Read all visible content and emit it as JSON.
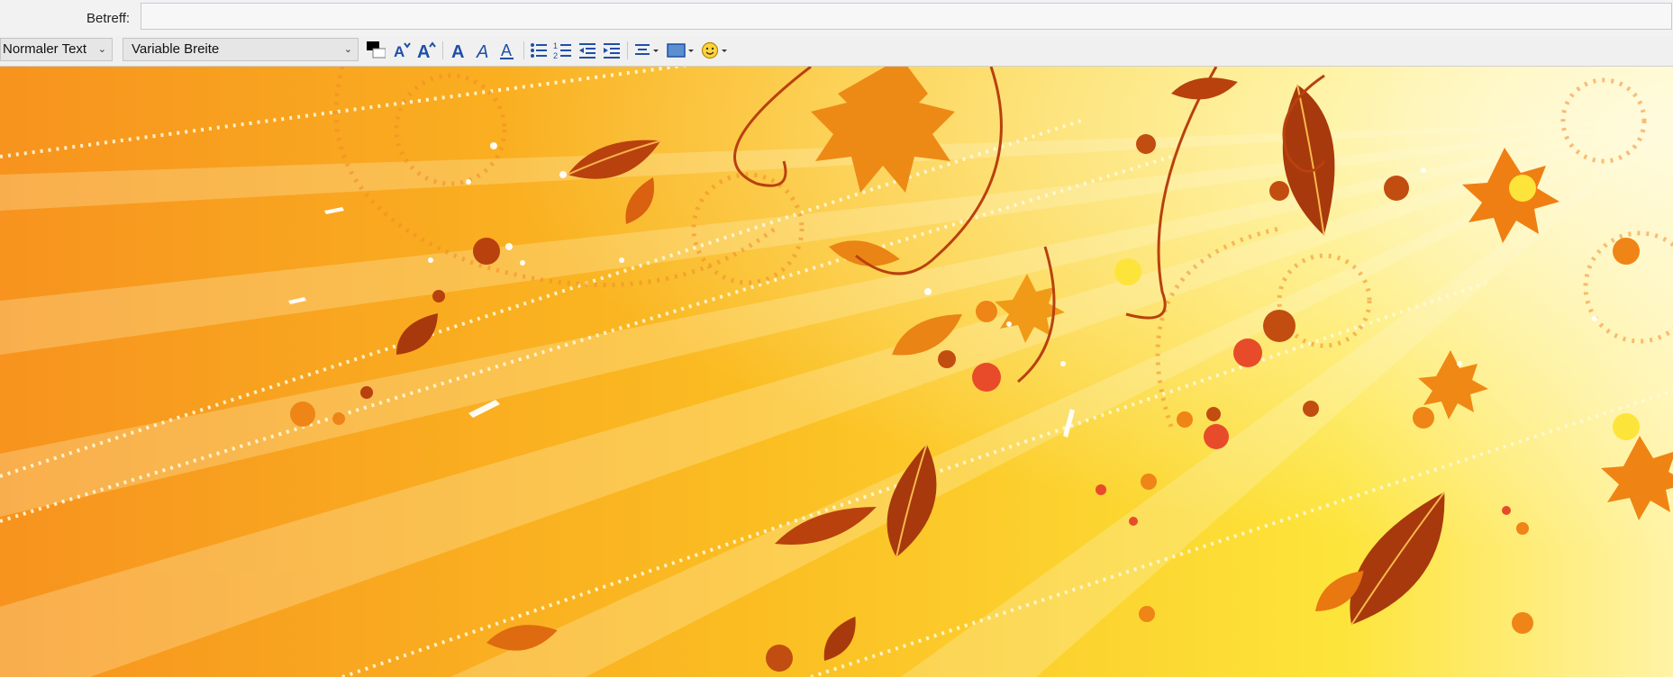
{
  "subject": {
    "label": "Betreff:",
    "value": ""
  },
  "toolbar": {
    "paragraph_style": "Normaler Text",
    "font_family": "Variable Breite",
    "text_color": "#000000",
    "icons": [
      "text-color-icon",
      "smaller-font-icon",
      "larger-font-icon",
      "bold-icon",
      "italic-icon",
      "underline-icon",
      "bullet-list-icon",
      "numbered-list-icon",
      "outdent-icon",
      "indent-icon",
      "align-icon",
      "insert-image-icon",
      "emoji-icon"
    ]
  },
  "background": {
    "theme": "autumn-leaves",
    "colors": {
      "orange": "#f7a11e",
      "yellow": "#fbe233",
      "leaf_dark": "#b3400f",
      "leaf_light": "#f29a18",
      "accent_red": "#e84b2a"
    }
  }
}
